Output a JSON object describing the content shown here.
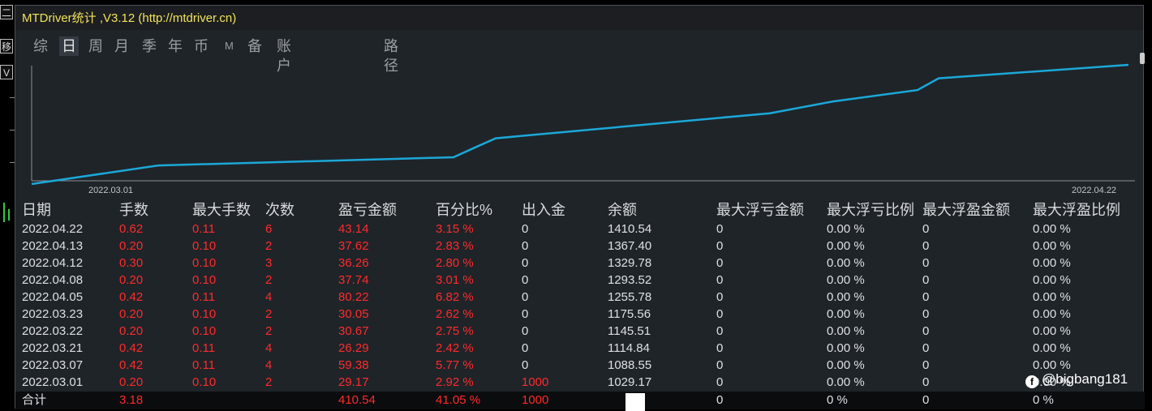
{
  "window": {
    "title": "MTDriver统计 ,V3.12 (http://mtdriver.cn)"
  },
  "left_strip": {
    "buttons": [
      "二",
      "移",
      "V"
    ]
  },
  "tabs": [
    {
      "label": "综",
      "active": false
    },
    {
      "label": "日",
      "active": true
    },
    {
      "label": "周",
      "active": false
    },
    {
      "label": "月",
      "active": false
    },
    {
      "label": "季",
      "active": false
    },
    {
      "label": "年",
      "active": false
    },
    {
      "label": "币",
      "active": false
    },
    {
      "label": "M",
      "active": false
    },
    {
      "label": "备",
      "active": false
    },
    {
      "label": "账户",
      "active": false
    },
    {
      "label": "路径",
      "active": false
    }
  ],
  "chart_data": {
    "type": "line",
    "x": [
      "2022.03.01",
      "2022.03.07",
      "2022.03.21",
      "2022.03.22",
      "2022.03.23",
      "2022.04.05",
      "2022.04.08",
      "2022.04.12",
      "2022.04.13",
      "2022.04.22"
    ],
    "values": [
      1029.17,
      1088.55,
      1114.84,
      1145.51,
      1175.56,
      1255.78,
      1293.52,
      1329.78,
      1367.4,
      1410.54
    ],
    "xtick_labels": [
      "2022.03.01",
      "2022.04.22"
    ],
    "line_color": "#1ba8d8"
  },
  "table": {
    "headers": [
      "日期",
      "手数",
      "最大手数",
      "次数",
      "盈亏金额",
      "百分比%",
      "出入金",
      "余额",
      "最大浮亏金额",
      "最大浮亏比例",
      "最大浮盈金额",
      "最大浮盈比例"
    ],
    "rows": [
      [
        "2022.04.22",
        "0.62",
        "0.11",
        "6",
        "43.14",
        "3.15 %",
        "0",
        "1410.54",
        "0",
        "0.00 %",
        "0",
        "0.00 %"
      ],
      [
        "2022.04.13",
        "0.20",
        "0.10",
        "2",
        "37.62",
        "2.83 %",
        "0",
        "1367.40",
        "0",
        "0.00 %",
        "0",
        "0.00 %"
      ],
      [
        "2022.04.12",
        "0.30",
        "0.10",
        "3",
        "36.26",
        "2.80 %",
        "0",
        "1329.78",
        "0",
        "0.00 %",
        "0",
        "0.00 %"
      ],
      [
        "2022.04.08",
        "0.20",
        "0.10",
        "2",
        "37.74",
        "3.01 %",
        "0",
        "1293.52",
        "0",
        "0.00 %",
        "0",
        "0.00 %"
      ],
      [
        "2022.04.05",
        "0.42",
        "0.11",
        "4",
        "80.22",
        "6.82 %",
        "0",
        "1255.78",
        "0",
        "0.00 %",
        "0",
        "0.00 %"
      ],
      [
        "2022.03.23",
        "0.20",
        "0.10",
        "2",
        "30.05",
        "2.62 %",
        "0",
        "1175.56",
        "0",
        "0.00 %",
        "0",
        "0.00 %"
      ],
      [
        "2022.03.22",
        "0.20",
        "0.10",
        "2",
        "30.67",
        "2.75 %",
        "0",
        "1145.51",
        "0",
        "0.00 %",
        "0",
        "0.00 %"
      ],
      [
        "2022.03.21",
        "0.42",
        "0.11",
        "4",
        "26.29",
        "2.42 %",
        "0",
        "1114.84",
        "0",
        "0.00 %",
        "0",
        "0.00 %"
      ],
      [
        "2022.03.07",
        "0.42",
        "0.11",
        "4",
        "59.38",
        "5.77 %",
        "0",
        "1088.55",
        "0",
        "0.00 %",
        "0",
        "0.00 %"
      ],
      [
        "2022.03.01",
        "0.20",
        "0.10",
        "2",
        "29.17",
        "2.92 %",
        "1000",
        "1029.17",
        "0",
        "0.00 %",
        "0",
        "0.00 %"
      ]
    ],
    "total": {
      "label": "合计",
      "lots": "3.18",
      "profit": "410.54",
      "percent": "41.05 %",
      "deposit": "1000",
      "max_float_loss": "0",
      "max_float_loss_pct": "0 %",
      "max_float_profit": "0",
      "max_float_profit_pct": "0 %"
    }
  },
  "watermark": {
    "text": "@bigbang181",
    "icon": "facebook-icon"
  },
  "colors": {
    "title": "#f1e35a",
    "positive": "#ff2a2a",
    "text": "#dde0e3",
    "panel": "#1f2429"
  }
}
